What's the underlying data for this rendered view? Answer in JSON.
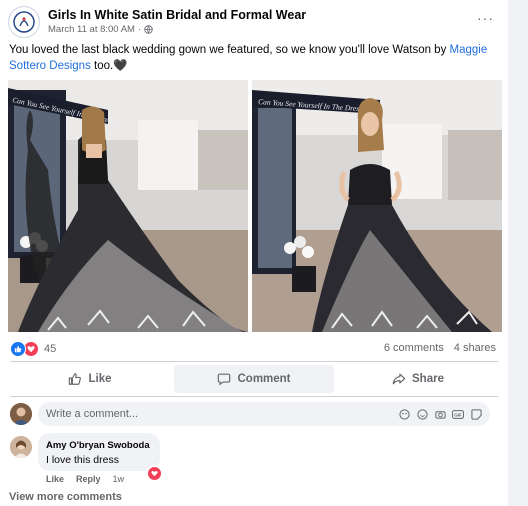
{
  "post": {
    "page_name": "Girls In White Satin Bridal and Formal Wear",
    "date": "March 11 at 8:00 AM",
    "privacy_icon": "globe-icon",
    "more_label": "···",
    "text_before": "You loved the last black wedding gown we featured, so we know you'll love Watson by ",
    "text_link": "Maggie Sottero Designs",
    "text_after": " too.",
    "text_emoji": "🖤",
    "photos": [
      {
        "desc": "bride-back-view",
        "banner": "Can You See Yourself In The Dress"
      },
      {
        "desc": "bride-front-view",
        "banner": "Can You See Yourself In The Dress"
      }
    ]
  },
  "stats": {
    "reaction_count": "45",
    "comments": "6 comments",
    "shares": "4 shares"
  },
  "actions": {
    "like": "Like",
    "comment": "Comment",
    "share": "Share"
  },
  "composer": {
    "placeholder": "Write a comment...",
    "icons": [
      "avatar-sticker-icon",
      "emoji-icon",
      "camera-icon",
      "gif-icon",
      "sticker-icon"
    ]
  },
  "comment": {
    "author": "Amy O'bryan Swoboda",
    "text": "I love this dress",
    "like": "Like",
    "reply": "Reply",
    "time": "1w"
  },
  "view_more": "View more comments",
  "colors": {
    "link": "#216fdb",
    "like_blue": "#1877f2",
    "love_red": "#f33e58",
    "muted": "#65676b",
    "bubble": "#f0f2f5"
  }
}
